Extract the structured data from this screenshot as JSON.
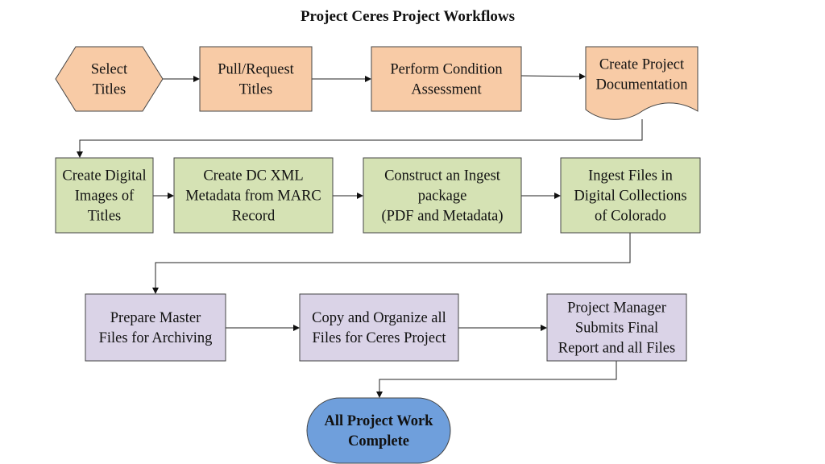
{
  "title": "Project Ceres Project Workflows",
  "colors": {
    "stage1": "#f8cba6",
    "stage2": "#d5e2b4",
    "stage3": "#dad3e7",
    "terminal": "#6f9fdc"
  },
  "nodes": [
    {
      "id": "select",
      "shape": "hexagon",
      "lines": [
        "Select",
        "Titles"
      ]
    },
    {
      "id": "pull",
      "shape": "process",
      "lines": [
        "Pull/Request",
        "Titles"
      ]
    },
    {
      "id": "assess",
      "shape": "process",
      "lines": [
        "Perform Condition",
        "Assessment"
      ]
    },
    {
      "id": "docs",
      "shape": "document",
      "lines": [
        "Create Project",
        "Documentation"
      ]
    },
    {
      "id": "images",
      "shape": "process",
      "lines": [
        "Create Digital",
        "Images of",
        "Titles"
      ]
    },
    {
      "id": "metadata",
      "shape": "process",
      "lines": [
        "Create DC XML",
        "Metadata from MARC",
        "Record"
      ]
    },
    {
      "id": "package",
      "shape": "process",
      "lines": [
        "Construct an Ingest",
        "package",
        "(PDF and Metadata)"
      ]
    },
    {
      "id": "ingest",
      "shape": "process",
      "lines": [
        "Ingest Files in",
        "Digital Collections",
        "of Colorado"
      ]
    },
    {
      "id": "master",
      "shape": "process",
      "lines": [
        "Prepare Master",
        "Files for Archiving"
      ]
    },
    {
      "id": "copy",
      "shape": "process",
      "lines": [
        "Copy and Organize all",
        "Files for Ceres Project"
      ]
    },
    {
      "id": "report",
      "shape": "process",
      "lines": [
        "Project Manager",
        "Submits Final",
        "Report and all Files"
      ]
    },
    {
      "id": "complete",
      "shape": "terminator",
      "lines": [
        "All Project Work",
        "Complete"
      ]
    }
  ]
}
